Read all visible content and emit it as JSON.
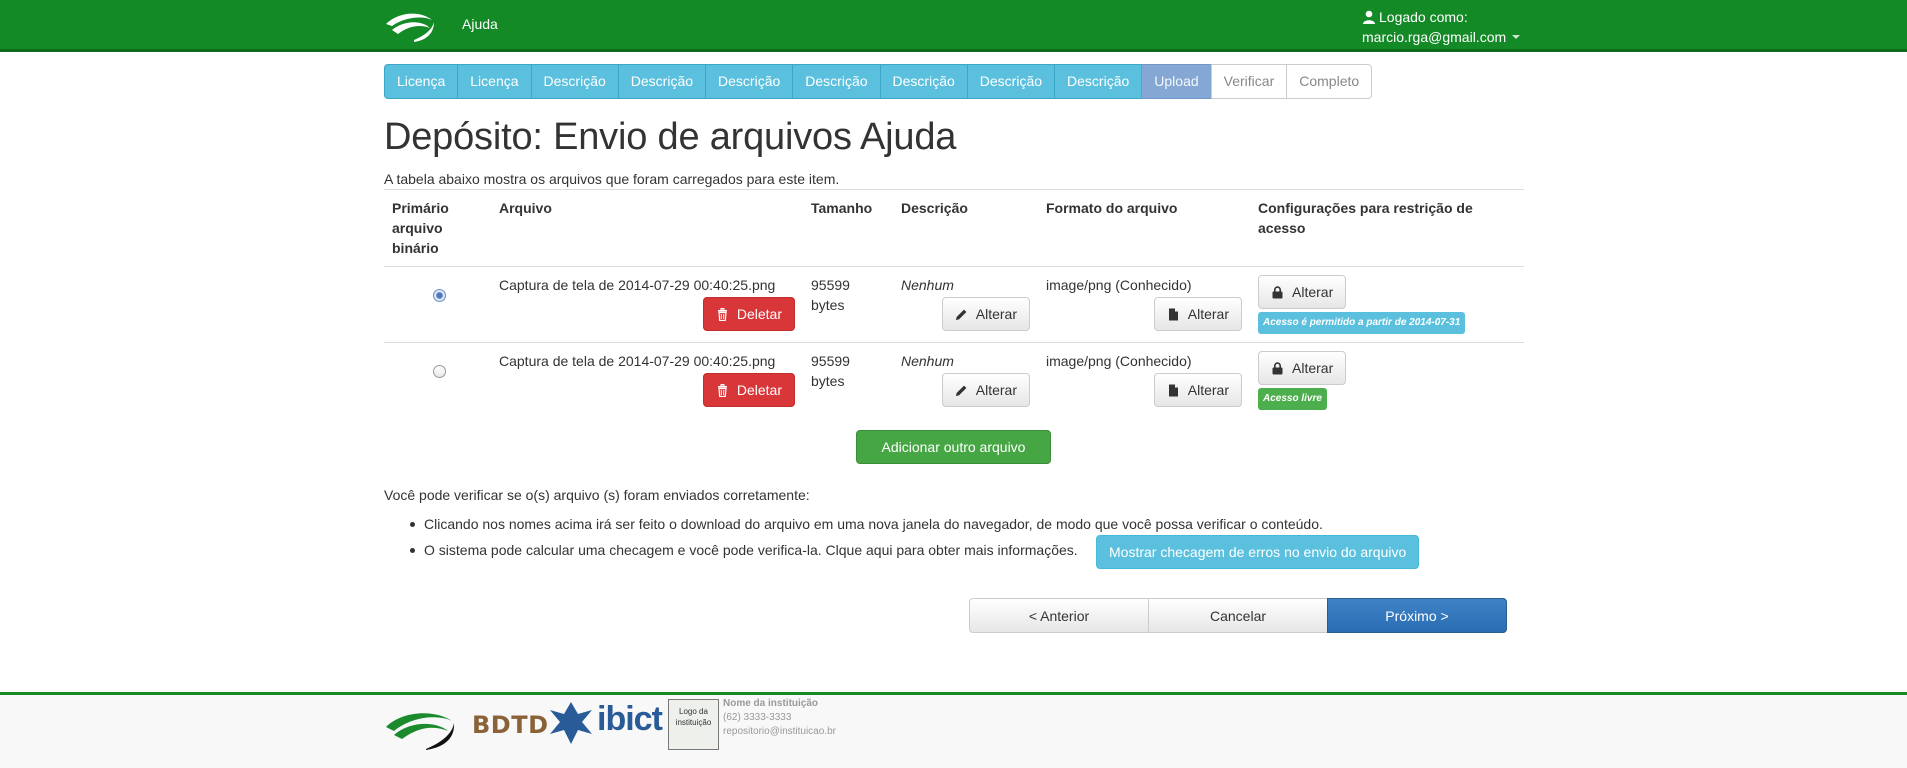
{
  "navbar": {
    "link": "Ajuda",
    "logged_as": "Logado como:",
    "email": "marcio.rga@gmail.com"
  },
  "trail": [
    {
      "label": "Licença",
      "state": "done"
    },
    {
      "label": "Licença",
      "state": "done"
    },
    {
      "label": "Descrição",
      "state": "done"
    },
    {
      "label": "Descrição",
      "state": "done"
    },
    {
      "label": "Descrição",
      "state": "done"
    },
    {
      "label": "Descrição",
      "state": "done"
    },
    {
      "label": "Descrição",
      "state": "done"
    },
    {
      "label": "Descrição",
      "state": "done"
    },
    {
      "label": "Descrição",
      "state": "done"
    },
    {
      "label": "Upload",
      "state": "current"
    },
    {
      "label": "Verificar",
      "state": "future"
    },
    {
      "label": "Completo",
      "state": "future"
    }
  ],
  "page": {
    "title": "Depósito: Envio de arquivos Ajuda",
    "intro": "A tabela abaixo mostra os arquivos que foram carregados para este item."
  },
  "table": {
    "headers": {
      "primary": "Primário arquivo binário",
      "file": "Arquivo",
      "size": "Tamanho",
      "description": "Descrição",
      "format": "Formato do arquivo",
      "access": "Configurações para restrição de acesso"
    },
    "rows": [
      {
        "primary_checked": true,
        "file": "Captura de tela de 2014-07-29 00:40:25.png",
        "delete_label": "Deletar",
        "size": "95599 bytes",
        "description": "Nenhum",
        "edit_label": "Alterar",
        "format": "image/png (Conhecido)",
        "format_label": "Alterar",
        "access_label": "Alterar",
        "badge": "Acesso é permitido a partir de 2014-07-31",
        "badge_color": "#5bc0de"
      },
      {
        "primary_checked": false,
        "file": "Captura de tela de 2014-07-29 00:40:25.png",
        "delete_label": "Deletar",
        "size": "95599 bytes",
        "description": "Nenhum",
        "edit_label": "Alterar",
        "format": "image/png (Conhecido)",
        "format_label": "Alterar",
        "access_label": "Alterar",
        "badge": "Acesso livre",
        "badge_color": "#4cae4c"
      }
    ]
  },
  "add_file_label": "Adicionar outro arquivo",
  "verify": {
    "text": "Você pode verificar se o(s) arquivo (s) foram enviados corretamente:",
    "item1": "Clicando nos nomes acima irá ser feito o download do arquivo em uma nova janela do navegador, de modo que você possa verificar o conteúdo.",
    "item2": "O sistema pode calcular uma checagem e você pode verifica-la. Clque aqui para obter mais informações.",
    "checksum_button": "Mostrar checagem de erros no envio do arquivo"
  },
  "actions": {
    "previous": "< Anterior",
    "cancel": "Cancelar",
    "next": "Próximo >"
  },
  "footer": {
    "bdtd": "BDTD",
    "ibict": "ibict",
    "inst_logo": "Logo da instituição",
    "inst_name": "Nome da instituição",
    "inst_phone": "(62) 3333-3333",
    "inst_email": "repositorio@instituicao.br"
  },
  "colors": {
    "brand_green": "#138a26",
    "trail_blue": "#5bc0de",
    "danger": "#d9363a",
    "success": "#46a644",
    "primary": "#2a6db2"
  }
}
